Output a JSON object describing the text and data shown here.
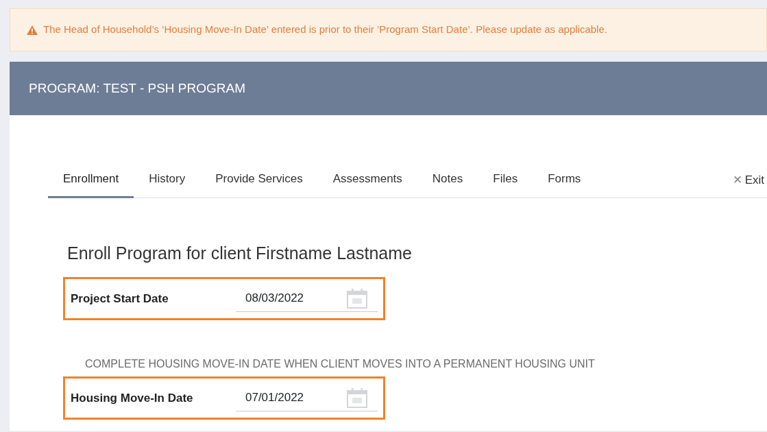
{
  "alert": {
    "text": "The Head of Household’s ‘Housing Move-In Date’ entered is prior to their ‘Program Start Date’. Please update as applicable."
  },
  "header": {
    "title": "PROGRAM: TEST - PSH PROGRAM"
  },
  "tabs": [
    {
      "label": "Enrollment",
      "selected": true
    },
    {
      "label": "History",
      "selected": false
    },
    {
      "label": "Provide Services",
      "selected": false
    },
    {
      "label": "Assessments",
      "selected": false
    },
    {
      "label": "Notes",
      "selected": false
    },
    {
      "label": "Files",
      "selected": false
    },
    {
      "label": "Forms",
      "selected": false
    }
  ],
  "exit": {
    "icon": "✕",
    "label": "Exit"
  },
  "heading": "Enroll Program for client Firstname Lastname",
  "sections": [
    {
      "field": {
        "label": "Project Start Date",
        "value": "08/03/2022",
        "highlighted": true
      }
    },
    {
      "caption": "COMPLETE HOUSING MOVE-IN DATE WHEN CLIENT MOVES INTO A PERMANENT HOUSING UNIT",
      "field": {
        "label": "Housing Move-In Date",
        "value": "07/01/2022",
        "highlighted": true
      }
    }
  ]
}
